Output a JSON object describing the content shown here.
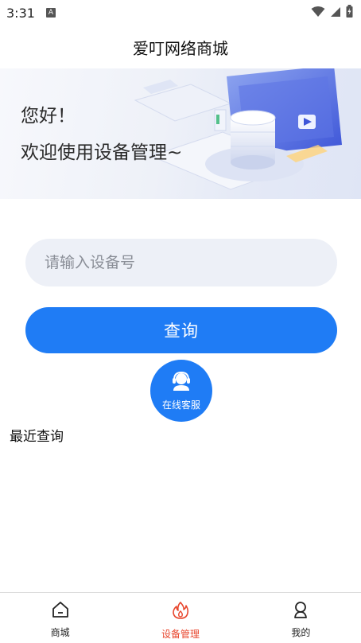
{
  "status_bar": {
    "time": "3:31",
    "notification_badge": "A",
    "icons": [
      "wifi-icon",
      "signal-icon",
      "battery-icon"
    ]
  },
  "header": {
    "title": "爱叮网络商城"
  },
  "banner": {
    "greeting": "您好！",
    "welcome": "欢迎使用设备管理~"
  },
  "search": {
    "placeholder": "请输入设备号",
    "value": ""
  },
  "query_button": {
    "label": "查询"
  },
  "customer_service": {
    "label": "在线客服",
    "icon": "headset-icon"
  },
  "recent": {
    "title": "最近查询",
    "items": []
  },
  "bottom_nav": {
    "items": [
      {
        "label": "商城",
        "icon": "home-icon",
        "active": false
      },
      {
        "label": "设备管理",
        "icon": "flame-icon",
        "active": true
      },
      {
        "label": "我的",
        "icon": "user-icon",
        "active": false
      }
    ]
  },
  "colors": {
    "accent": "#1f7cf5",
    "active_nav": "#e8452c",
    "input_bg": "#edf0f7"
  }
}
